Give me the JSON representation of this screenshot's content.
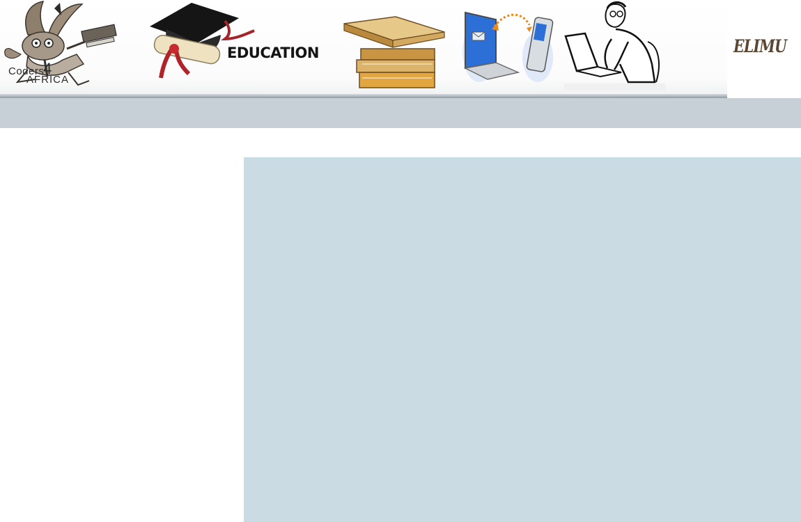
{
  "header": {
    "logo": {
      "line1": "Coders",
      "line2": "AFRICA",
      "numeral": "4"
    },
    "education_label": "EDUCATION",
    "site_title": "ELIMU"
  },
  "nav": {
    "items": []
  },
  "sidebar": {
    "items": []
  },
  "main": {
    "content": ""
  }
}
